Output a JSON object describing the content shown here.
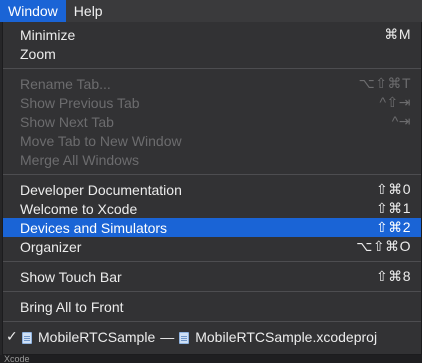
{
  "menubar": {
    "items": [
      {
        "label": "Window",
        "active": true
      },
      {
        "label": "Help",
        "active": false
      }
    ]
  },
  "menu": {
    "group1": [
      {
        "label": "Minimize",
        "shortcut": "⌘M",
        "enabled": true
      },
      {
        "label": "Zoom",
        "shortcut": "",
        "enabled": true
      }
    ],
    "group2": [
      {
        "label": "Rename Tab...",
        "shortcut": "⌥⇧⌘T",
        "enabled": false
      },
      {
        "label": "Show Previous Tab",
        "shortcut": "^⇧⇥",
        "enabled": false
      },
      {
        "label": "Show Next Tab",
        "shortcut": "^⇥",
        "enabled": false
      },
      {
        "label": "Move Tab to New Window",
        "shortcut": "",
        "enabled": false
      },
      {
        "label": "Merge All Windows",
        "shortcut": "",
        "enabled": false
      }
    ],
    "group3": [
      {
        "label": "Developer Documentation",
        "shortcut": "⇧⌘0",
        "enabled": true
      },
      {
        "label": "Welcome to Xcode",
        "shortcut": "⇧⌘1",
        "enabled": true
      },
      {
        "label": "Devices and Simulators",
        "shortcut": "⇧⌘2",
        "enabled": true,
        "highlighted": true
      },
      {
        "label": "Organizer",
        "shortcut": "⌥⇧⌘O",
        "enabled": true
      }
    ],
    "group4": [
      {
        "label": "Show Touch Bar",
        "shortcut": "⇧⌘8",
        "enabled": true
      }
    ],
    "group5": [
      {
        "label": "Bring All to Front",
        "shortcut": "",
        "enabled": true
      }
    ],
    "windows": [
      {
        "checked": true,
        "check_glyph": "✓",
        "project": "MobileRTCSample",
        "separator": "—",
        "file": "MobileRTCSample.xcodeproj"
      }
    ]
  },
  "colors": {
    "highlight": "#1a64d6",
    "menu_bg": "#323234",
    "disabled_text": "#6c6c6e"
  },
  "bottom_strip": {
    "text": "Xcode"
  }
}
